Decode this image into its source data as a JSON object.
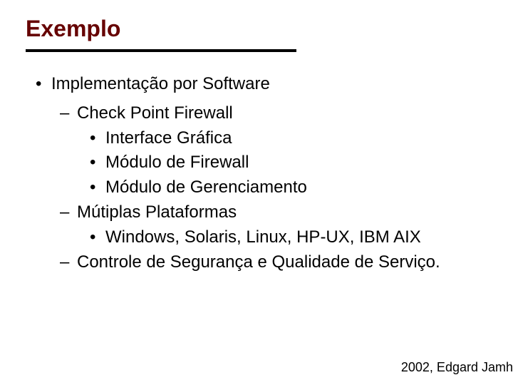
{
  "title": "Exemplo",
  "main": {
    "label": "Implementação por Software",
    "sub1": {
      "label": "Check Point Firewall",
      "items": [
        "Interface Gráfica",
        "Módulo de Firewall",
        "Módulo de Gerenciamento"
      ]
    },
    "sub2": {
      "label": "Mútiplas Plataformas",
      "items": [
        "Windows, Solaris, Linux, HP-UX, IBM AIX"
      ]
    },
    "sub3": {
      "label": "Controle de Segurança e Qualidade de Serviço."
    }
  },
  "footer": "2002, Edgard Jamh"
}
